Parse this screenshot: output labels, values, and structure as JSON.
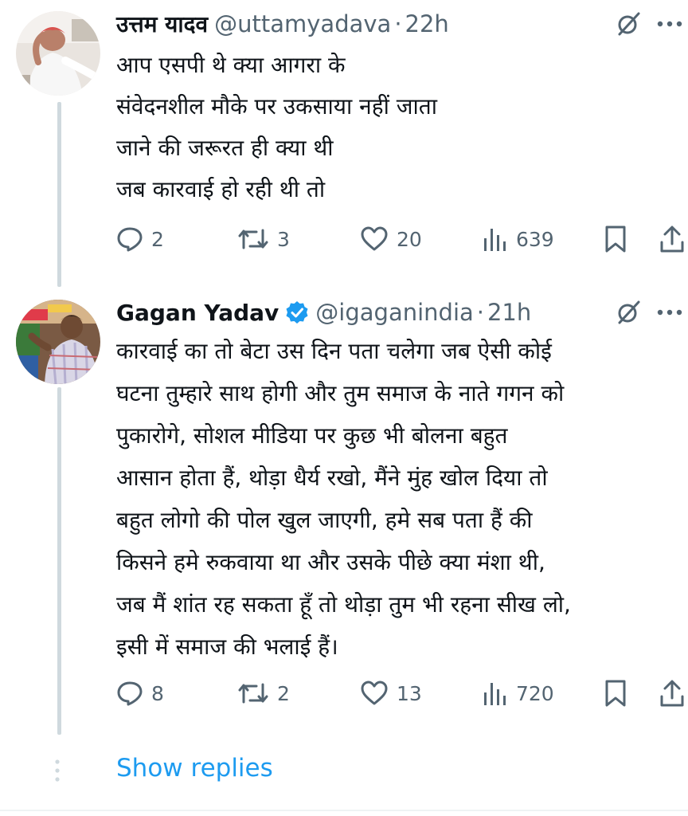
{
  "tweets": [
    {
      "author_name": "उत्तम यादव",
      "handle": "@uttamyadava",
      "separator": "·",
      "time": "22h",
      "verified": false,
      "text_lines": [
        "आप एसपी थे क्या आगरा के",
        "संवेदनशील मौके पर उकसाया नहीं जाता",
        "जाने की जरूरत ही क्या थी",
        "जब कारवाई हो रही थी तो"
      ],
      "stats": {
        "replies": "2",
        "reposts": "3",
        "likes": "20",
        "views": "639"
      },
      "icons": [
        "avatar",
        "grok-icon",
        "more-icon",
        "reply-icon",
        "repost-icon",
        "like-icon",
        "views-icon",
        "bookmark-icon",
        "share-icon"
      ]
    },
    {
      "author_name": "Gagan Yadav",
      "handle": "@igaganindia",
      "separator": "·",
      "time": "21h",
      "verified": true,
      "text_lines": [
        "कारवाई का तो बेटा उस दिन पता चलेगा जब ऐसी कोई",
        "घटना तुम्हारे साथ होगी और तुम समाज के नाते गगन को",
        "पुकारोगे, सोशल मीडिया पर कुछ भी बोलना बहुत",
        "आसान होता हैं, थोड़ा धैर्य रखो, मैंने मुंह खोल दिया तो",
        "बहुत लोगो की पोल खुल जाएगी, हमे सब पता हैं की",
        "किसने हमे रुकवाया था और उसके पीछे क्या मंशा थी,",
        "जब मैं शांत रह सकता हूँ तो थोड़ा तुम भी रहना सीख लो,",
        "इसी में समाज की भलाई हैं।"
      ],
      "stats": {
        "replies": "8",
        "reposts": "2",
        "likes": "13",
        "views": "720"
      }
    }
  ],
  "show_replies_label": "Show replies",
  "colors": {
    "text_primary": "#0f1419",
    "text_secondary": "#536471",
    "link_blue": "#1d9bf0",
    "thread_line": "#cfd9de",
    "verified_blue": "#1d9bf0"
  }
}
